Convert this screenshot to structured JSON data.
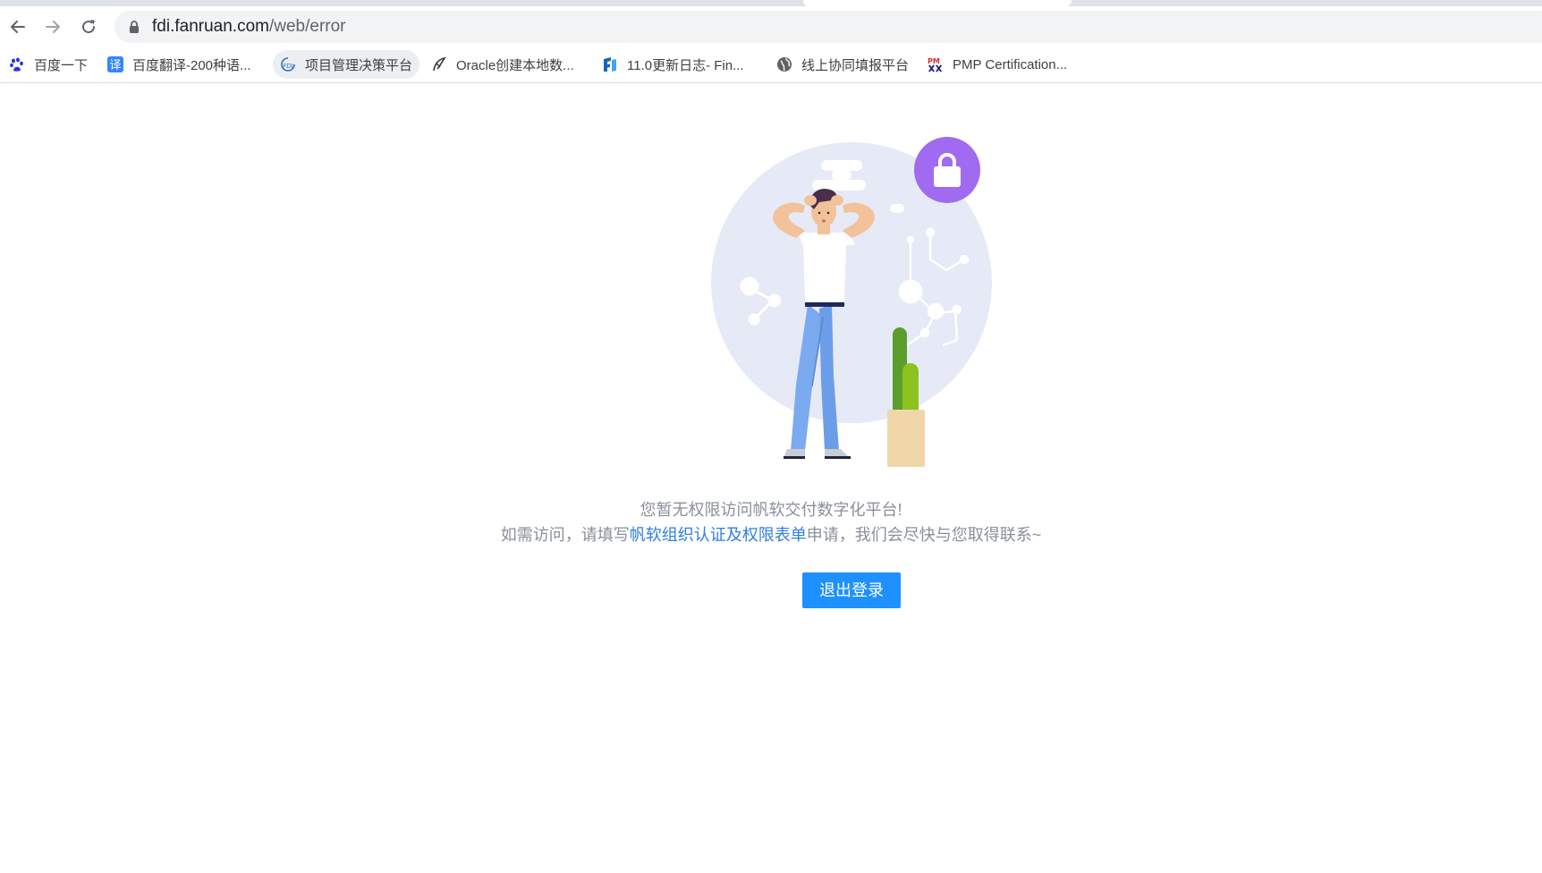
{
  "browser": {
    "url_host": "fdi.fanruan.com",
    "url_path": "/web/error",
    "bookmarks": [
      {
        "label": "百度一下",
        "icon": "baidu-paw-icon",
        "color": "#2932e1"
      },
      {
        "label": "百度翻译-200种语...",
        "icon": "translate-icon",
        "color": "#3385ff"
      },
      {
        "label": "项目管理决策平台",
        "icon": "fdi-logo-icon",
        "color": "#2f6fce"
      },
      {
        "label": "Oracle创建本地数...",
        "icon": "oracle-feather-icon",
        "color": "#333333"
      },
      {
        "label": "11.0更新日志- Fin...",
        "icon": "finereport-logo-icon",
        "color": "#1565c0"
      },
      {
        "label": "线上协同填报平台",
        "icon": "globe-icon",
        "color": "#5f6368"
      },
      {
        "label": "PMP Certification...",
        "icon": "pmp-logo-icon",
        "color": "#d32f2f"
      }
    ]
  },
  "page": {
    "message_line1": "您暂无权限访问帆软交付数字化平台!",
    "message_line2_prefix": "如需访问，请填写",
    "message_link": "帆软组织认证及权限表单",
    "message_line2_suffix": "申请，我们会尽快与您取得联系~",
    "logout_button": "退出登录"
  },
  "colors": {
    "accent": "#1e90ff",
    "link": "#2f7ee6",
    "lock_badge": "#a06bf0",
    "circle_bg": "#e6eaf6"
  }
}
